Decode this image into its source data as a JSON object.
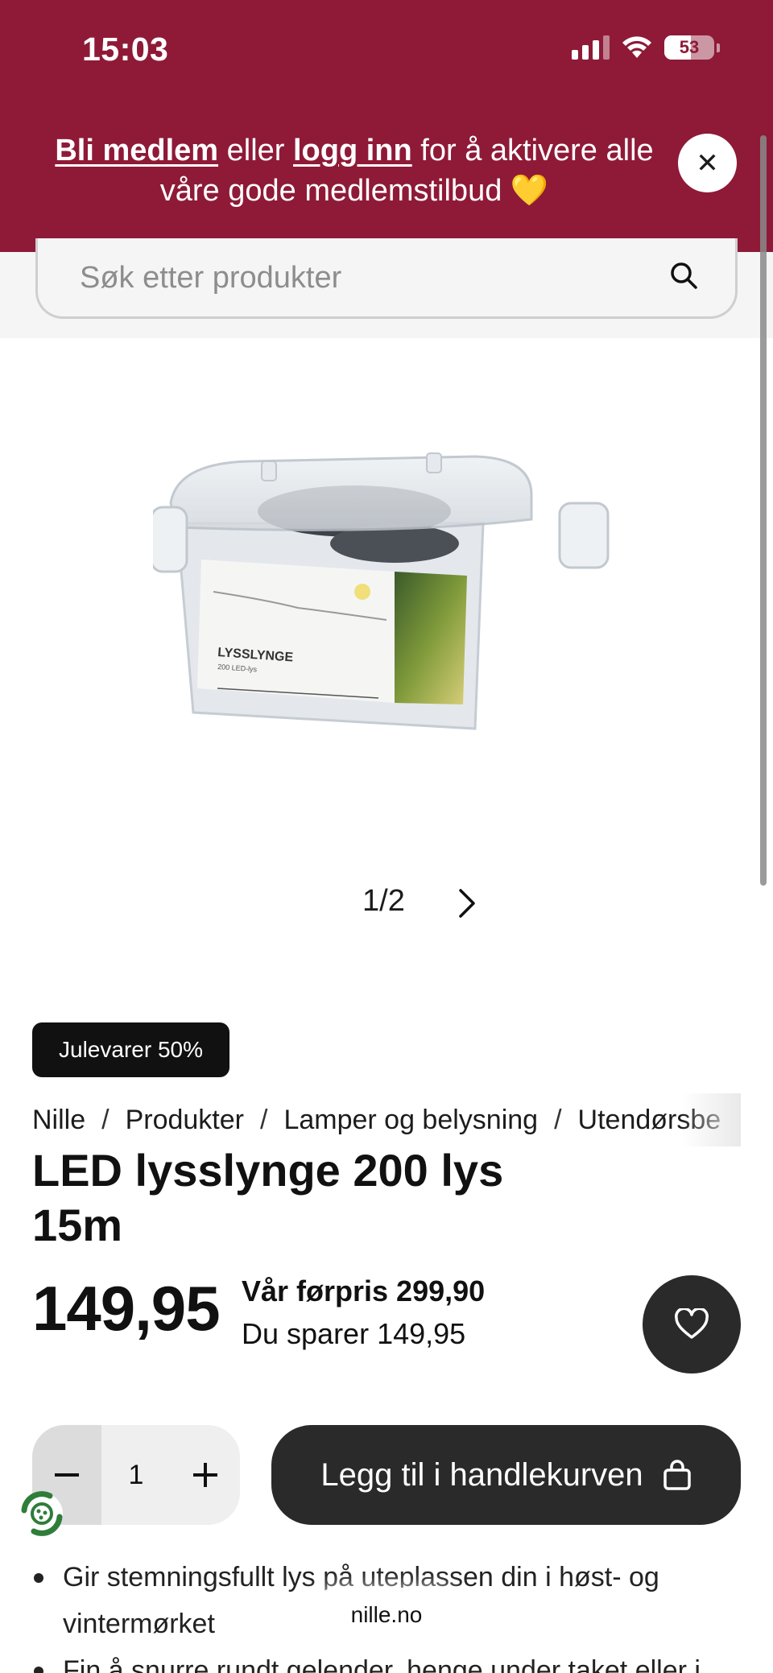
{
  "status_bar": {
    "time": "15:03",
    "battery": "53"
  },
  "banner": {
    "link_join": "Bli medlem",
    "text_or": " eller ",
    "link_login": "logg inn",
    "text_rest": " for å aktivere alle våre gode medlemstilbud 💛",
    "close_glyph": "✕"
  },
  "search": {
    "placeholder": "Søk etter produkter"
  },
  "gallery": {
    "pager": "1/2"
  },
  "product": {
    "badge": "Julevarer 50%",
    "breadcrumb": [
      "Nille",
      "Produkter",
      "Lamper og belysning",
      "Utendørsbe"
    ],
    "title": "LED lysslynge 200 lys 15m",
    "price": "149,95",
    "previous_price": "Vår førpris 299,90",
    "savings": "Du sparer 149,95",
    "quantity": "1",
    "add_to_cart": "Legg til i handlekurven",
    "package_label": "LYSSLYNGE",
    "package_sublabel": "200 LED-lys"
  },
  "features": [
    "Gir stemningsfullt lys på uteplassen din i høst- og vintermørket",
    "Fin å snurre rundt gelender, henge under taket eller i"
  ],
  "browser": {
    "url": "nille.no"
  },
  "colors": {
    "brand": "#8e1a37",
    "button_dark": "#2a2a2a"
  }
}
